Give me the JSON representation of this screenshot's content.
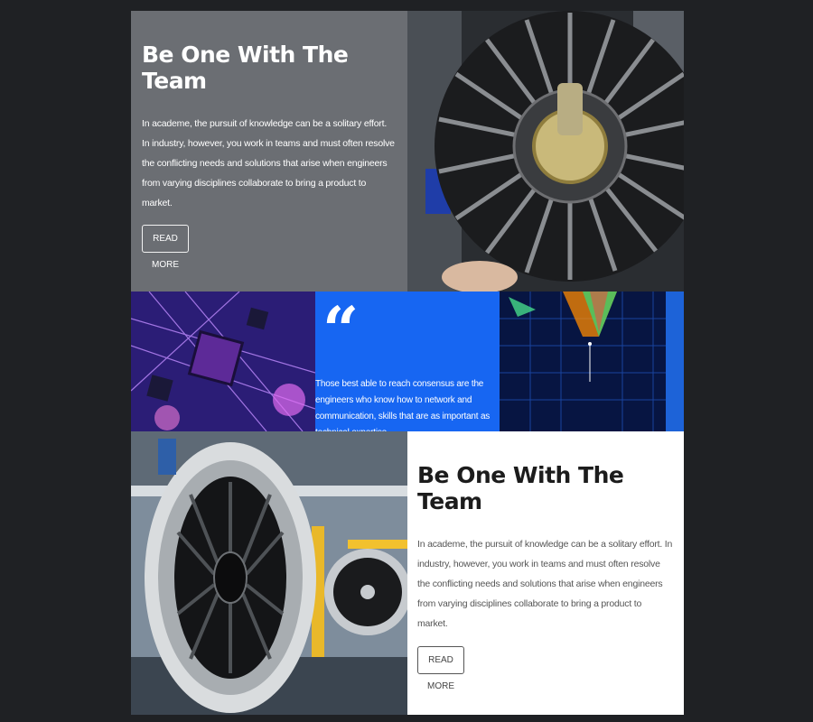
{
  "sections": {
    "top_card": {
      "title": "Be One With The Team",
      "body": "In academe, the pursuit of knowledge can be a solitary effort. In industry, however, you work in teams and must often resolve the conflicting needs and solutions that arise when engineers from varying disciplines collaborate to bring a product to market.",
      "button_label": "READ MORE"
    },
    "quote": {
      "mark": "“",
      "text": "Those best able to reach consensus are the engineers who know how to network and communication, skills that are as important as technical expertise"
    },
    "bottom_card": {
      "title": "Be One With The Team",
      "body": "In academe, the pursuit of knowledge can be a solitary effort. In industry, however, you work in teams and must often resolve the conflicting needs and solutions that arise when engineers from varying disciplines collaborate to bring a product to market.",
      "button_label": "READ MORE"
    }
  },
  "colors": {
    "page_background": "#1f2124",
    "grey_card": "#6b6e73",
    "quote_card": "#1766f2",
    "white_card": "#ffffff"
  }
}
